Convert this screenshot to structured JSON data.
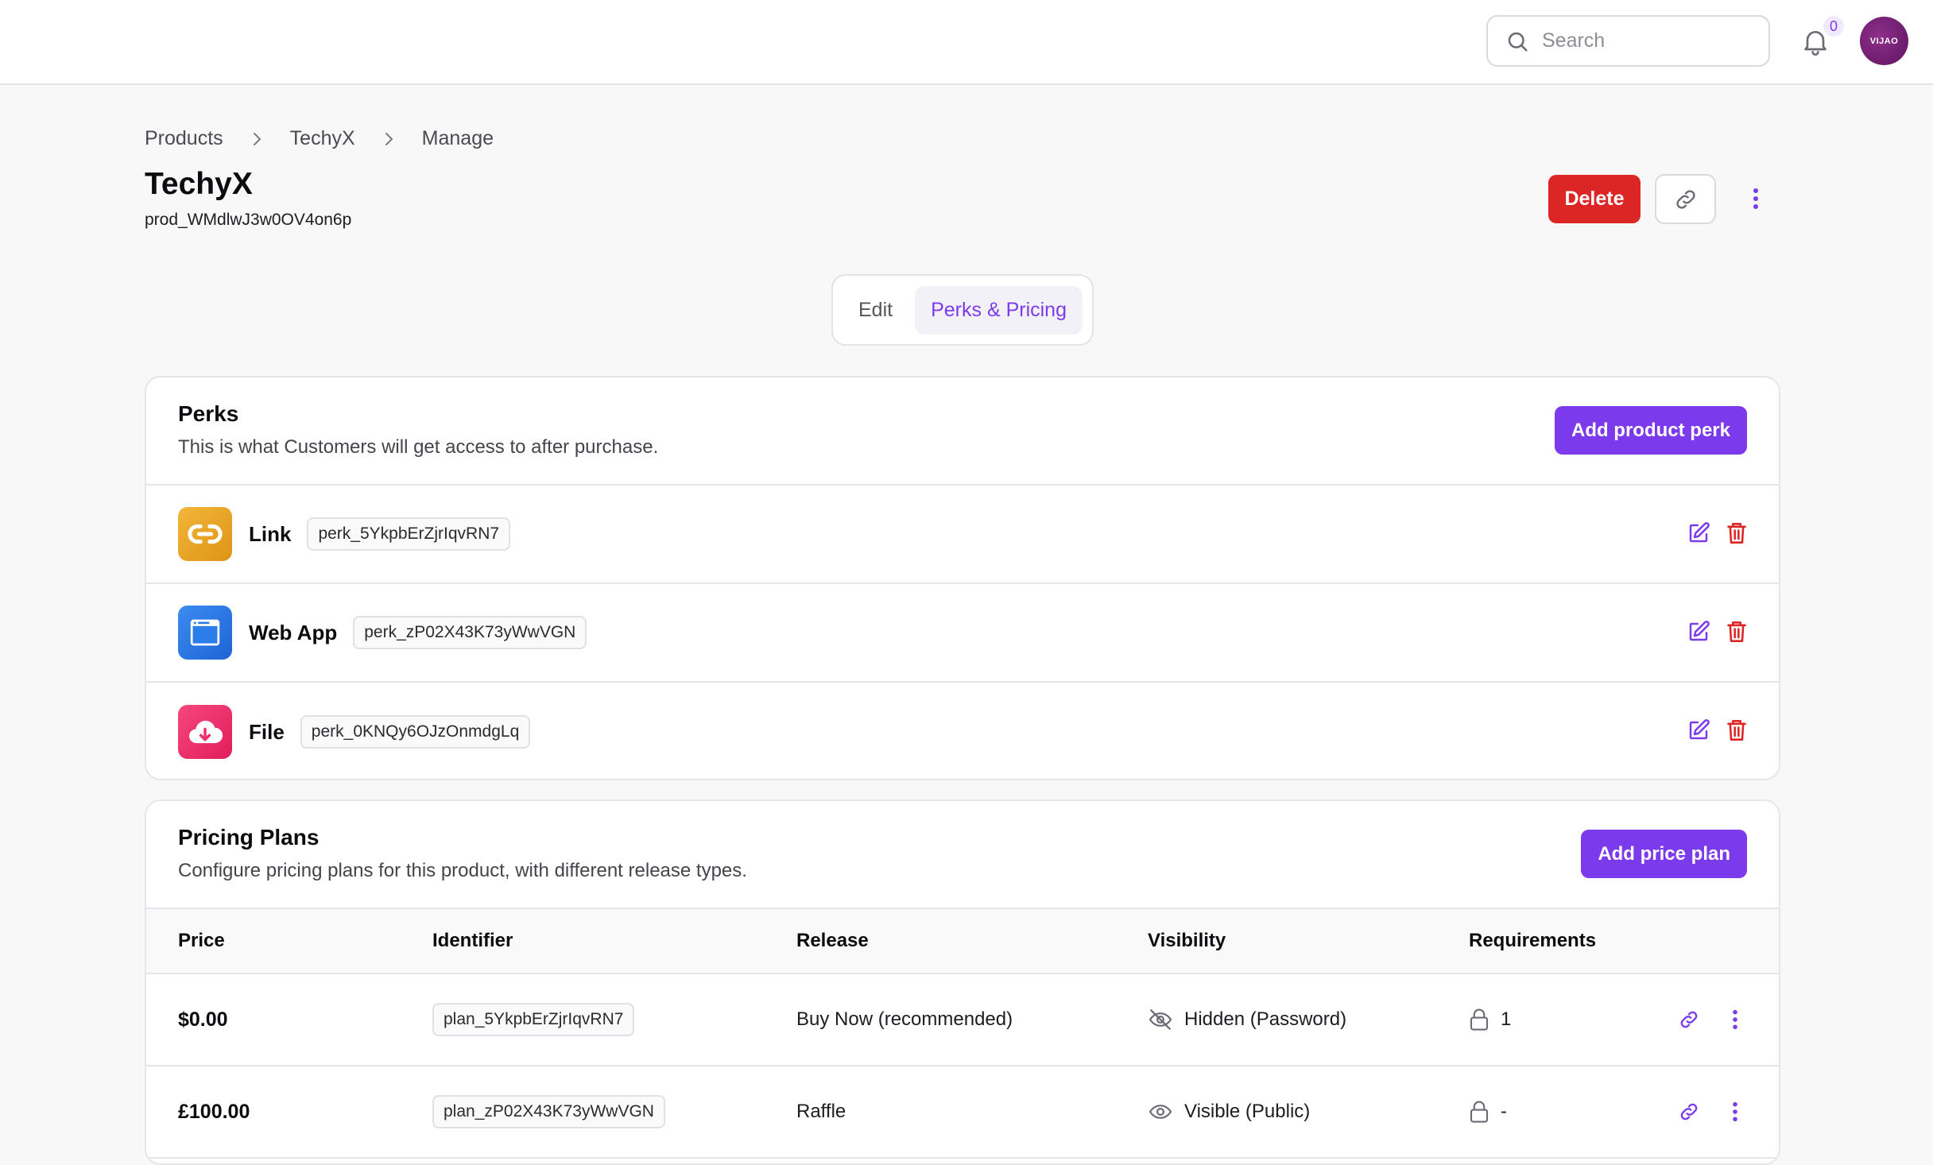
{
  "header": {
    "search_placeholder": "Search",
    "notification_count": "0",
    "avatar_text": "VIJAO"
  },
  "breadcrumb": [
    "Products",
    "TechyX",
    "Manage"
  ],
  "product": {
    "title": "TechyX",
    "id": "prod_WMdlwJ3w0OV4on6p"
  },
  "actions": {
    "delete_label": "Delete"
  },
  "tabs": [
    {
      "label": "Edit",
      "active": false
    },
    {
      "label": "Perks & Pricing",
      "active": true
    }
  ],
  "perks": {
    "title": "Perks",
    "description": "This is what Customers will get access to after purchase.",
    "add_label": "Add product perk",
    "items": [
      {
        "name": "Link",
        "id": "perk_5YkpbErZjrIqvRN7",
        "icon": "link-icon",
        "color": "#e9a623"
      },
      {
        "name": "Web App",
        "id": "perk_zP02X43K73yWwVGN",
        "icon": "browser-window-icon",
        "color": "#2b7de9"
      },
      {
        "name": "File",
        "id": "perk_0KNQy6OJzOnmdgLq",
        "icon": "cloud-download-icon",
        "color": "#ee2f6e"
      }
    ]
  },
  "pricing": {
    "title": "Pricing Plans",
    "description": "Configure pricing plans for this product, with different release types.",
    "add_label": "Add price plan",
    "columns": [
      "Price",
      "Identifier",
      "Release",
      "Visibility",
      "Requirements"
    ],
    "rows": [
      {
        "price": "$0.00",
        "identifier": "plan_5YkpbErZjrIqvRN7",
        "release": "Buy Now (recommended)",
        "visibility": "Hidden (Password)",
        "visibility_icon": "eye-off-icon",
        "requirements": "1"
      },
      {
        "price": "£100.00",
        "identifier": "plan_zP02X43K73yWwVGN",
        "release": "Raffle",
        "visibility": "Visible (Public)",
        "visibility_icon": "eye-icon",
        "requirements": "-"
      }
    ]
  },
  "colors": {
    "accent": "#7c3aed",
    "danger": "#dc2626"
  }
}
